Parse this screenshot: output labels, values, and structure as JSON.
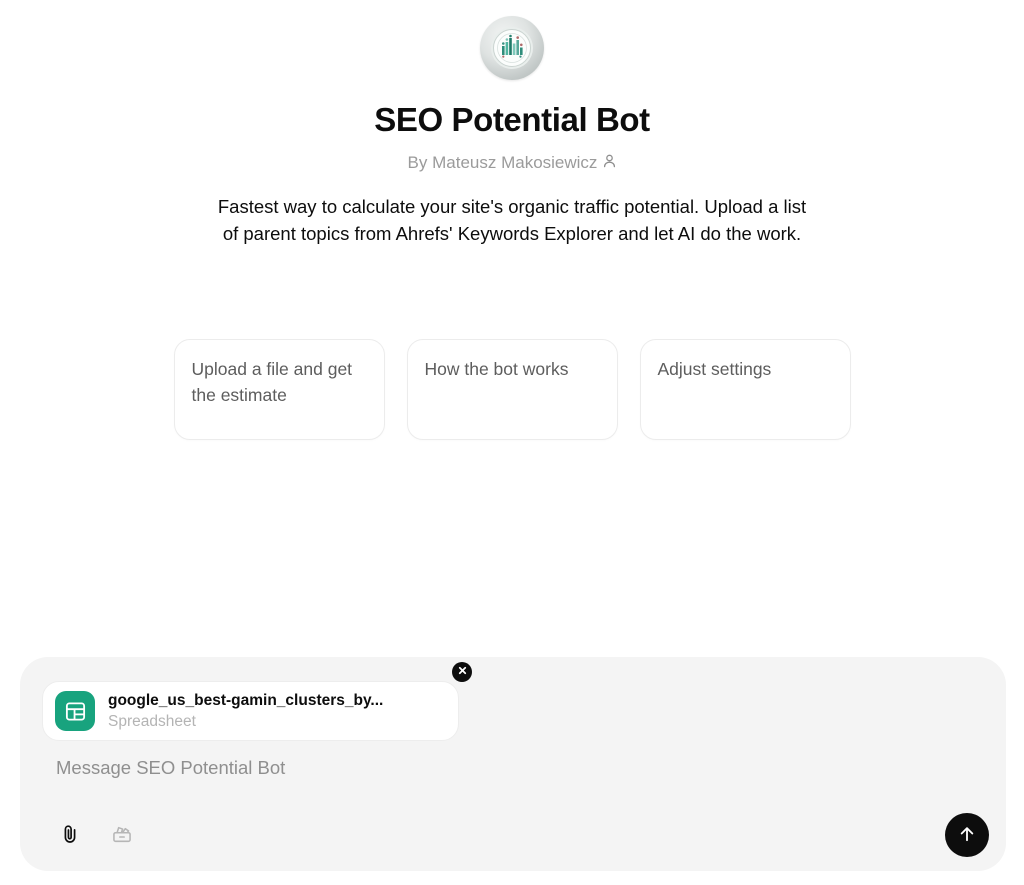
{
  "bot": {
    "avatar_icon": "bar-chart-emblem-icon",
    "title": "SEO Potential Bot",
    "byline": "By Mateusz Makosiewicz",
    "byline_icon": "person-icon",
    "description": "Fastest way to calculate your site's organic traffic potential. Upload a list of parent topics from Ahrefs' Keywords Explorer and let AI do the work."
  },
  "suggestions": [
    {
      "label": "Upload a file and get the estimate"
    },
    {
      "label": "How the bot works"
    },
    {
      "label": "Adjust settings"
    }
  ],
  "composer": {
    "attachment": {
      "name": "google_us_best-gamin_clusters_by...",
      "type": "Spreadsheet",
      "icon": "spreadsheet-icon",
      "icon_color": "#18a37e",
      "remove_icon": "close-icon"
    },
    "placeholder": "Message SEO Potential Bot",
    "actions": [
      {
        "name": "attach-file-button",
        "icon": "paperclip-icon"
      },
      {
        "name": "tools-button",
        "icon": "toolbox-icon"
      }
    ],
    "send": {
      "icon": "arrow-up-icon",
      "color": "#0d0d0d"
    }
  }
}
